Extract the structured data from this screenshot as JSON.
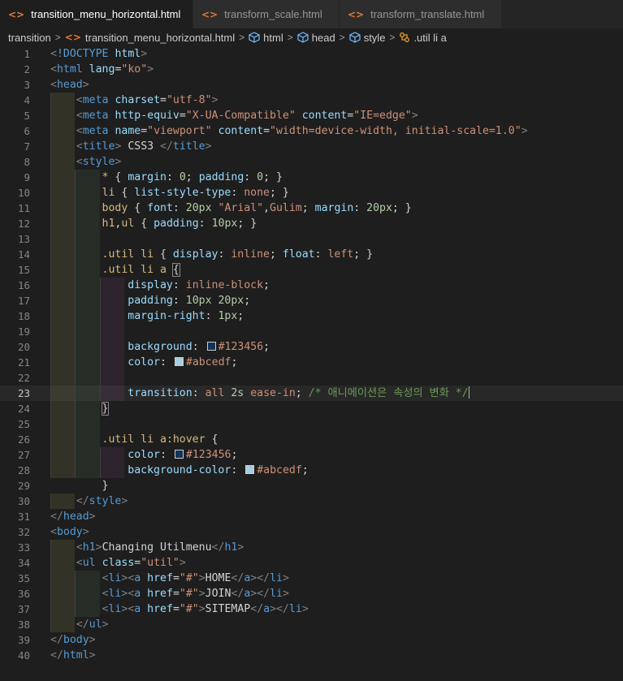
{
  "tabs": [
    {
      "label": "transition_menu_horizontal.html",
      "modified": true,
      "active": true
    },
    {
      "label": "transform_scale.html",
      "modified": false,
      "active": false
    },
    {
      "label": "transform_translate.html",
      "modified": false,
      "active": false
    }
  ],
  "breadcrumb": [
    "transition",
    "transition_menu_horizontal.html",
    "html",
    "head",
    "style",
    ".util li a"
  ],
  "lines": [
    {
      "n": "1",
      "t": [
        [
          "p",
          "<"
        ],
        [
          "t",
          "!DOCTYPE"
        ],
        [
          "x",
          " "
        ],
        [
          "a",
          "html"
        ],
        [
          "p",
          ">"
        ]
      ]
    },
    {
      "n": "2",
      "t": [
        [
          "p",
          "<"
        ],
        [
          "t",
          "html"
        ],
        [
          "x",
          " "
        ],
        [
          "a",
          "lang"
        ],
        [
          "x",
          "="
        ],
        [
          "s",
          "\"ko\""
        ],
        [
          "p",
          ">"
        ]
      ]
    },
    {
      "n": "3",
      "t": [
        [
          "p",
          "<"
        ],
        [
          "t",
          "head"
        ],
        [
          "p",
          ">"
        ]
      ]
    },
    {
      "n": "4",
      "t": [
        [
          "x",
          "    "
        ],
        [
          "p",
          "<"
        ],
        [
          "t",
          "meta"
        ],
        [
          "x",
          " "
        ],
        [
          "a",
          "charset"
        ],
        [
          "x",
          "="
        ],
        [
          "s",
          "\"utf-8\""
        ],
        [
          "p",
          ">"
        ]
      ]
    },
    {
      "n": "5",
      "t": [
        [
          "x",
          "    "
        ],
        [
          "p",
          "<"
        ],
        [
          "t",
          "meta"
        ],
        [
          "x",
          " "
        ],
        [
          "a",
          "http-equiv"
        ],
        [
          "x",
          "="
        ],
        [
          "s",
          "\"X-UA-Compatible\""
        ],
        [
          "x",
          " "
        ],
        [
          "a",
          "content"
        ],
        [
          "x",
          "="
        ],
        [
          "s",
          "\"IE=edge\""
        ],
        [
          "p",
          ">"
        ]
      ]
    },
    {
      "n": "6",
      "t": [
        [
          "x",
          "    "
        ],
        [
          "p",
          "<"
        ],
        [
          "t",
          "meta"
        ],
        [
          "x",
          " "
        ],
        [
          "a",
          "name"
        ],
        [
          "x",
          "="
        ],
        [
          "s",
          "\"viewport\""
        ],
        [
          "x",
          " "
        ],
        [
          "a",
          "content"
        ],
        [
          "x",
          "="
        ],
        [
          "s",
          "\"width=device-width, initial-scale=1.0\""
        ],
        [
          "p",
          ">"
        ]
      ]
    },
    {
      "n": "7",
      "t": [
        [
          "x",
          "    "
        ],
        [
          "p",
          "<"
        ],
        [
          "t",
          "title"
        ],
        [
          "p",
          ">"
        ],
        [
          "x",
          " CSS3 "
        ],
        [
          "p",
          "</"
        ],
        [
          "t",
          "title"
        ],
        [
          "p",
          ">"
        ]
      ]
    },
    {
      "n": "8",
      "t": [
        [
          "x",
          "    "
        ],
        [
          "p",
          "<"
        ],
        [
          "t",
          "style"
        ],
        [
          "p",
          ">"
        ]
      ]
    },
    {
      "n": "9",
      "t": [
        [
          "x",
          "        "
        ],
        [
          "sel",
          "*"
        ],
        [
          "x",
          " { "
        ],
        [
          "a",
          "margin"
        ],
        [
          "x",
          ": "
        ],
        [
          "n",
          "0"
        ],
        [
          "x",
          "; "
        ],
        [
          "a",
          "padding"
        ],
        [
          "x",
          ": "
        ],
        [
          "n",
          "0"
        ],
        [
          "x",
          "; }"
        ]
      ]
    },
    {
      "n": "10",
      "t": [
        [
          "x",
          "        "
        ],
        [
          "sel",
          "li"
        ],
        [
          "x",
          " { "
        ],
        [
          "a",
          "list-style-type"
        ],
        [
          "x",
          ": "
        ],
        [
          "s",
          "none"
        ],
        [
          "x",
          "; }"
        ]
      ]
    },
    {
      "n": "11",
      "t": [
        [
          "x",
          "        "
        ],
        [
          "sel",
          "body"
        ],
        [
          "x",
          " { "
        ],
        [
          "a",
          "font"
        ],
        [
          "x",
          ": "
        ],
        [
          "n",
          "20px"
        ],
        [
          "x",
          " "
        ],
        [
          "s",
          "\"Arial\""
        ],
        [
          "x",
          ","
        ],
        [
          "s",
          "Gulim"
        ],
        [
          "x",
          "; "
        ],
        [
          "a",
          "margin"
        ],
        [
          "x",
          ": "
        ],
        [
          "n",
          "20px"
        ],
        [
          "x",
          "; }"
        ]
      ]
    },
    {
      "n": "12",
      "t": [
        [
          "x",
          "        "
        ],
        [
          "sel",
          "h1"
        ],
        [
          "x",
          ","
        ],
        [
          "sel",
          "ul"
        ],
        [
          "x",
          " { "
        ],
        [
          "a",
          "padding"
        ],
        [
          "x",
          ": "
        ],
        [
          "n",
          "10px"
        ],
        [
          "x",
          "; }"
        ]
      ]
    },
    {
      "n": "13",
      "t": []
    },
    {
      "n": "14",
      "t": [
        [
          "x",
          "        "
        ],
        [
          "sel",
          ".util li"
        ],
        [
          "x",
          " { "
        ],
        [
          "a",
          "display"
        ],
        [
          "x",
          ": "
        ],
        [
          "s",
          "inline"
        ],
        [
          "x",
          "; "
        ],
        [
          "a",
          "float"
        ],
        [
          "x",
          ": "
        ],
        [
          "s",
          "left"
        ],
        [
          "x",
          "; }"
        ]
      ]
    },
    {
      "n": "15",
      "t": [
        [
          "x",
          "        "
        ],
        [
          "sel",
          ".util li a"
        ],
        [
          "x",
          " "
        ],
        [
          "bm",
          "{"
        ]
      ]
    },
    {
      "n": "16",
      "t": [
        [
          "x",
          "            "
        ],
        [
          "a",
          "display"
        ],
        [
          "x",
          ": "
        ],
        [
          "s",
          "inline-block"
        ],
        [
          "x",
          ";"
        ]
      ]
    },
    {
      "n": "17",
      "t": [
        [
          "x",
          "            "
        ],
        [
          "a",
          "padding"
        ],
        [
          "x",
          ": "
        ],
        [
          "n",
          "10px"
        ],
        [
          "x",
          " "
        ],
        [
          "n",
          "20px"
        ],
        [
          "x",
          ";"
        ]
      ]
    },
    {
      "n": "18",
      "t": [
        [
          "x",
          "            "
        ],
        [
          "a",
          "margin-right"
        ],
        [
          "x",
          ": "
        ],
        [
          "n",
          "1px"
        ],
        [
          "x",
          ";"
        ]
      ]
    },
    {
      "n": "19",
      "t": []
    },
    {
      "n": "20",
      "t": [
        [
          "x",
          "            "
        ],
        [
          "a",
          "background"
        ],
        [
          "x",
          ": "
        ],
        [
          "sw",
          "#123456"
        ],
        [
          "s",
          "#123456"
        ],
        [
          "x",
          ";"
        ]
      ]
    },
    {
      "n": "21",
      "t": [
        [
          "x",
          "            "
        ],
        [
          "a",
          "color"
        ],
        [
          "x",
          ": "
        ],
        [
          "sw",
          "#abcedf"
        ],
        [
          "s",
          "#abcedf"
        ],
        [
          "x",
          ";"
        ]
      ]
    },
    {
      "n": "22",
      "t": []
    },
    {
      "n": "23",
      "t": [
        [
          "x",
          "            "
        ],
        [
          "a",
          "transition"
        ],
        [
          "x",
          ": "
        ],
        [
          "s",
          "all"
        ],
        [
          "x",
          " "
        ],
        [
          "n",
          "2s"
        ],
        [
          "x",
          " "
        ],
        [
          "s",
          "ease-in"
        ],
        [
          "x",
          "; "
        ],
        [
          "c",
          "/* 애니메이션은 속성의 변화 */"
        ],
        [
          "cur",
          ""
        ]
      ]
    },
    {
      "n": "24",
      "t": [
        [
          "x",
          "        "
        ],
        [
          "bm",
          "}"
        ]
      ]
    },
    {
      "n": "25",
      "t": []
    },
    {
      "n": "26",
      "t": [
        [
          "x",
          "        "
        ],
        [
          "sel",
          ".util li a:hover"
        ],
        [
          "x",
          " {"
        ]
      ]
    },
    {
      "n": "27",
      "t": [
        [
          "x",
          "            "
        ],
        [
          "a",
          "color"
        ],
        [
          "x",
          ": "
        ],
        [
          "sw",
          "#123456"
        ],
        [
          "s",
          "#123456"
        ],
        [
          "x",
          ";"
        ]
      ]
    },
    {
      "n": "28",
      "t": [
        [
          "x",
          "            "
        ],
        [
          "a",
          "background-color"
        ],
        [
          "x",
          ": "
        ],
        [
          "sw",
          "#abcedf"
        ],
        [
          "s",
          "#abcedf"
        ],
        [
          "x",
          ";"
        ]
      ]
    },
    {
      "n": "29",
      "t": [
        [
          "x",
          "        }"
        ]
      ]
    },
    {
      "n": "30",
      "t": [
        [
          "x",
          "    "
        ],
        [
          "p",
          "</"
        ],
        [
          "t",
          "style"
        ],
        [
          "p",
          ">"
        ]
      ]
    },
    {
      "n": "31",
      "t": [
        [
          "p",
          "</"
        ],
        [
          "t",
          "head"
        ],
        [
          "p",
          ">"
        ]
      ]
    },
    {
      "n": "32",
      "t": [
        [
          "p",
          "<"
        ],
        [
          "t",
          "body"
        ],
        [
          "p",
          ">"
        ]
      ]
    },
    {
      "n": "33",
      "t": [
        [
          "x",
          "    "
        ],
        [
          "p",
          "<"
        ],
        [
          "t",
          "h1"
        ],
        [
          "p",
          ">"
        ],
        [
          "x",
          "Changing Utilmenu"
        ],
        [
          "p",
          "</"
        ],
        [
          "t",
          "h1"
        ],
        [
          "p",
          ">"
        ]
      ]
    },
    {
      "n": "34",
      "t": [
        [
          "x",
          "    "
        ],
        [
          "p",
          "<"
        ],
        [
          "t",
          "ul"
        ],
        [
          "x",
          " "
        ],
        [
          "a",
          "class"
        ],
        [
          "x",
          "="
        ],
        [
          "s",
          "\"util\""
        ],
        [
          "p",
          ">"
        ]
      ]
    },
    {
      "n": "35",
      "t": [
        [
          "x",
          "        "
        ],
        [
          "p",
          "<"
        ],
        [
          "t",
          "li"
        ],
        [
          "p",
          "><"
        ],
        [
          "t",
          "a"
        ],
        [
          "x",
          " "
        ],
        [
          "a",
          "href"
        ],
        [
          "x",
          "="
        ],
        [
          "s",
          "\"#\""
        ],
        [
          "p",
          ">"
        ],
        [
          "x",
          "HOME"
        ],
        [
          "p",
          "</"
        ],
        [
          "t",
          "a"
        ],
        [
          "p",
          "></"
        ],
        [
          "t",
          "li"
        ],
        [
          "p",
          ">"
        ]
      ]
    },
    {
      "n": "36",
      "t": [
        [
          "x",
          "        "
        ],
        [
          "p",
          "<"
        ],
        [
          "t",
          "li"
        ],
        [
          "p",
          "><"
        ],
        [
          "t",
          "a"
        ],
        [
          "x",
          " "
        ],
        [
          "a",
          "href"
        ],
        [
          "x",
          "="
        ],
        [
          "s",
          "\"#\""
        ],
        [
          "p",
          ">"
        ],
        [
          "x",
          "JOIN"
        ],
        [
          "p",
          "</"
        ],
        [
          "t",
          "a"
        ],
        [
          "p",
          "></"
        ],
        [
          "t",
          "li"
        ],
        [
          "p",
          ">"
        ]
      ]
    },
    {
      "n": "37",
      "t": [
        [
          "x",
          "        "
        ],
        [
          "p",
          "<"
        ],
        [
          "t",
          "li"
        ],
        [
          "p",
          "><"
        ],
        [
          "t",
          "a"
        ],
        [
          "x",
          " "
        ],
        [
          "a",
          "href"
        ],
        [
          "x",
          "="
        ],
        [
          "s",
          "\"#\""
        ],
        [
          "p",
          ">"
        ],
        [
          "x",
          "SITEMAP"
        ],
        [
          "p",
          "</"
        ],
        [
          "t",
          "a"
        ],
        [
          "p",
          "></"
        ],
        [
          "t",
          "li"
        ],
        [
          "p",
          ">"
        ]
      ]
    },
    {
      "n": "38",
      "t": [
        [
          "x",
          "    "
        ],
        [
          "p",
          "</"
        ],
        [
          "t",
          "ul"
        ],
        [
          "p",
          ">"
        ]
      ]
    },
    {
      "n": "39",
      "t": [
        [
          "p",
          "</"
        ],
        [
          "t",
          "body"
        ],
        [
          "p",
          ">"
        ]
      ]
    },
    {
      "n": "40",
      "t": [
        [
          "p",
          "</"
        ],
        [
          "t",
          "html"
        ],
        [
          "p",
          ">"
        ]
      ]
    }
  ],
  "cursor_line": "23"
}
